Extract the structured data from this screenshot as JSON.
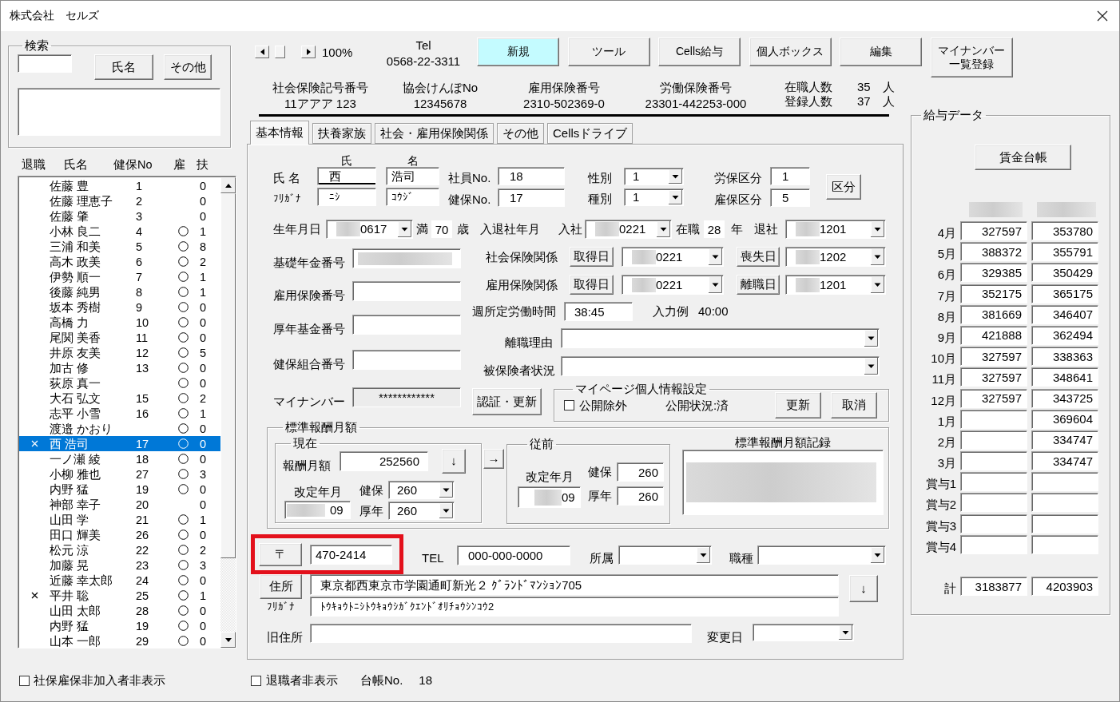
{
  "window": {
    "title": "株式会社　セルズ"
  },
  "search": {
    "title": "検索",
    "buttons": [
      "氏名",
      "その他"
    ]
  },
  "employee_list": {
    "columns": [
      "退職",
      "氏名",
      "健保No",
      "雇",
      "扶"
    ],
    "rows": [
      {
        "retired": false,
        "name": "佐藤 豊",
        "health_no": "1",
        "employment_insured": false,
        "dependents": "0",
        "selected": false
      },
      {
        "retired": false,
        "name": "佐藤 理恵子",
        "health_no": "2",
        "employment_insured": false,
        "dependents": "0",
        "selected": false
      },
      {
        "retired": false,
        "name": "佐藤 肇",
        "health_no": "3",
        "employment_insured": false,
        "dependents": "0",
        "selected": false
      },
      {
        "retired": false,
        "name": "小林 良二",
        "health_no": "4",
        "employment_insured": true,
        "dependents": "1",
        "selected": false
      },
      {
        "retired": false,
        "name": "三浦 和美",
        "health_no": "5",
        "employment_insured": true,
        "dependents": "8",
        "selected": false
      },
      {
        "retired": false,
        "name": "高木 政美",
        "health_no": "6",
        "employment_insured": true,
        "dependents": "2",
        "selected": false
      },
      {
        "retired": false,
        "name": "伊勢 順一",
        "health_no": "7",
        "employment_insured": true,
        "dependents": "1",
        "selected": false
      },
      {
        "retired": false,
        "name": "後藤 純男",
        "health_no": "8",
        "employment_insured": true,
        "dependents": "1",
        "selected": false
      },
      {
        "retired": false,
        "name": "坂本 秀樹",
        "health_no": "9",
        "employment_insured": true,
        "dependents": "0",
        "selected": false
      },
      {
        "retired": false,
        "name": "高橋 力",
        "health_no": "10",
        "employment_insured": true,
        "dependents": "0",
        "selected": false
      },
      {
        "retired": false,
        "name": "尾関 美香",
        "health_no": "11",
        "employment_insured": true,
        "dependents": "0",
        "selected": false
      },
      {
        "retired": false,
        "name": "井原 友美",
        "health_no": "12",
        "employment_insured": true,
        "dependents": "5",
        "selected": false
      },
      {
        "retired": false,
        "name": "加古 修",
        "health_no": "13",
        "employment_insured": true,
        "dependents": "0",
        "selected": false
      },
      {
        "retired": false,
        "name": "荻原 真一",
        "employment_insured": true,
        "dependents": "0",
        "selected": false
      },
      {
        "retired": false,
        "name": "大石 弘文",
        "health_no": "15",
        "employment_insured": true,
        "dependents": "2",
        "selected": false
      },
      {
        "retired": false,
        "name": "志平 小雪",
        "health_no": "16",
        "employment_insured": true,
        "dependents": "1",
        "selected": false
      },
      {
        "retired": false,
        "name": "渡邉 かおり",
        "employment_insured": true,
        "dependents": "0",
        "selected": false
      },
      {
        "retired": true,
        "name": "西 浩司",
        "health_no": "17",
        "employment_insured": true,
        "dependents": "0",
        "selected": true
      },
      {
        "retired": false,
        "name": "一ノ瀬 綾",
        "health_no": "18",
        "employment_insured": true,
        "dependents": "0",
        "selected": false
      },
      {
        "retired": false,
        "name": "小柳 雅也",
        "health_no": "27",
        "employment_insured": true,
        "dependents": "3",
        "selected": false
      },
      {
        "retired": false,
        "name": "内野 猛",
        "health_no": "19",
        "employment_insured": true,
        "dependents": "0",
        "selected": false
      },
      {
        "retired": false,
        "name": "神部 幸子",
        "health_no": "20",
        "employment_insured": false,
        "dependents": "0",
        "selected": false
      },
      {
        "retired": false,
        "name": "山田 学",
        "health_no": "21",
        "employment_insured": true,
        "dependents": "1",
        "selected": false
      },
      {
        "retired": false,
        "name": "田口 輝美",
        "health_no": "26",
        "employment_insured": true,
        "dependents": "0",
        "selected": false
      },
      {
        "retired": false,
        "name": "松元 涼",
        "health_no": "22",
        "employment_insured": true,
        "dependents": "2",
        "selected": false
      },
      {
        "retired": false,
        "name": "加藤 晃",
        "health_no": "23",
        "employment_insured": true,
        "dependents": "3",
        "selected": false
      },
      {
        "retired": false,
        "name": "近藤 幸太郎",
        "health_no": "24",
        "employment_insured": true,
        "dependents": "0",
        "selected": false
      },
      {
        "retired": true,
        "name": "平井 聡",
        "health_no": "25",
        "employment_insured": true,
        "dependents": "1",
        "selected": false
      },
      {
        "retired": false,
        "name": "山田 太郎",
        "health_no": "28",
        "employment_insured": true,
        "dependents": "0",
        "selected": false
      },
      {
        "retired": false,
        "name": "内野 猛",
        "health_no": "19",
        "employment_insured": true,
        "dependents": "0",
        "selected": false
      },
      {
        "retired": false,
        "name": "山本 一郎",
        "health_no": "29",
        "employment_insured": true,
        "dependents": "0",
        "selected": false
      }
    ]
  },
  "hide_uninsured": {
    "label": "社保雇保非加入者非表示",
    "checked": false
  },
  "toolbar": {
    "zoom": "100%",
    "tel_label": "Tel",
    "tel": "0568-22-3311",
    "buttons": [
      {
        "label": "新規",
        "highlighted": true
      },
      {
        "label": "ツール",
        "highlighted": false
      },
      {
        "label": "Cells給与",
        "highlighted": false
      },
      {
        "label": "個人ボックス",
        "highlighted": false
      },
      {
        "label": "編集",
        "highlighted": false
      },
      {
        "label": "マイナンバー一覧登録",
        "highlighted": false
      }
    ]
  },
  "office_numbers": [
    {
      "label": "社会保険記号番号",
      "value": "11アアア 123"
    },
    {
      "label": "協会けんぽNo",
      "value": "12345678"
    },
    {
      "label": "雇用保険番号",
      "value": "2310-502369-0"
    },
    {
      "label": "労働保険番号",
      "value": "23301-442253-000"
    }
  ],
  "headcount": [
    {
      "label": "在職人数",
      "value": "35",
      "unit": "人"
    },
    {
      "label": "登録人数",
      "value": "37",
      "unit": "人"
    }
  ],
  "tabs": [
    {
      "label": "基本情報",
      "selected": true
    },
    {
      "label": "扶養家族",
      "selected": false
    },
    {
      "label": "社会・雇用保険関係",
      "selected": false
    },
    {
      "label": "その他",
      "selected": false
    },
    {
      "label": "Cellsドライブ",
      "selected": false
    }
  ],
  "basic_info": {
    "name": {
      "surname_heading": "氏",
      "given_heading": "名",
      "label": "氏 名",
      "surname": "西",
      "surname_focused": true,
      "given": "浩司",
      "kana_label": "ﾌﾘｶﾞﾅ",
      "surname_kana": "ﾆｼ",
      "given_kana": "ｺｳｼﾞ"
    },
    "numbers": [
      {
        "label": "社員No.",
        "value": "18"
      },
      {
        "label": "健保No.",
        "value": "17"
      }
    ],
    "selects": [
      {
        "label": "性別",
        "value": "1"
      },
      {
        "label": "種別",
        "value": "1"
      }
    ],
    "classes": [
      {
        "label": "労保区分",
        "value": "1"
      },
      {
        "label": "雇保区分",
        "value": "5"
      }
    ],
    "class_button": "区分",
    "birth": {
      "label": "生年月日",
      "value": "0617",
      "age_prefix": "満",
      "age": "70",
      "age_unit": "歳"
    },
    "tenure": {
      "label": "入退社年月",
      "join_label": "入社",
      "join": "0221",
      "years_label": "在職",
      "years": "28",
      "years_unit": "年",
      "leave_label": "退社",
      "leave": "1201"
    },
    "id_fields": [
      {
        "label": "基礎年金番号",
        "kind": "blurred"
      },
      {
        "label": "雇用保険番号",
        "kind": "text"
      },
      {
        "label": "厚年基金番号",
        "kind": "text"
      },
      {
        "label": "健保組合番号",
        "kind": "text"
      },
      {
        "label": "マイナンバー",
        "kind": "readonly",
        "value": "************"
      }
    ],
    "insurance_rows": [
      {
        "label": "社会保険関係",
        "acquire_button": "取得日",
        "acquire": "0221",
        "lose_button": "喪失日",
        "lose": "1202"
      },
      {
        "label": "雇用保険関係",
        "acquire_button": "取得日",
        "acquire": "0221",
        "lose_button": "離職日",
        "lose": "1201"
      }
    ],
    "weekly_hours": {
      "label": "週所定労働時間",
      "value": "38:45",
      "example_label": "入力例",
      "example": "40:00"
    },
    "leave_reason": {
      "label": "離職理由"
    },
    "insured_status": {
      "label": "被保険者状況"
    },
    "auth_button": "認証・更新",
    "mypage": {
      "title": "マイページ個人情報設定",
      "exclude_label": "公開除外",
      "exclude_checked": false,
      "status": "公開状況:済",
      "buttons": [
        "更新",
        "取消"
      ]
    },
    "standard_pay": {
      "title": "標準報酬月額",
      "current": {
        "title": "現在",
        "pay_label": "報酬月額",
        "pay": "252560",
        "down_button": "↓",
        "revision_label": "改定年月",
        "revision": "09",
        "health_label": "健保",
        "health": "260",
        "pension_label": "厚年",
        "pension": "260"
      },
      "copy_button": "→",
      "previous": {
        "title": "従前",
        "revision_label": "改定年月",
        "revision": "09",
        "health_label": "健保",
        "health": "260",
        "pension_label": "厚年",
        "pension": "260"
      },
      "record_title": "標準報酬月額記録"
    },
    "address": {
      "postal_button": "〒",
      "postal": "470-2414",
      "postal_highlighted": true,
      "tel_label": "TEL",
      "tel": "000-000-0000",
      "dept_label": "所属",
      "job_label": "職種",
      "address_button": "住所",
      "address": "東京都西東京市学園通町新光２ ｸﾞﾗﾝﾄﾞﾏﾝｼｮﾝ705",
      "kana_label": "ﾌﾘｶﾞﾅ",
      "address_kana": "ﾄｳｷｮｳﾄﾆｼﾄｳｷｮｳｼｶﾞｸｴﾝﾄﾞｵﾘﾁｮｳｼﾝｺｳ2",
      "copy_button": "↓",
      "old_label": "旧住所",
      "change_label": "変更日"
    }
  },
  "salary_data": {
    "title": "給与データ",
    "button": "賃金台帳",
    "rows": [
      {
        "label": "4月",
        "column_1": "327597",
        "column_2": "353780"
      },
      {
        "label": "5月",
        "column_1": "388372",
        "column_2": "355791"
      },
      {
        "label": "6月",
        "column_1": "329385",
        "column_2": "350429"
      },
      {
        "label": "7月",
        "column_1": "352175",
        "column_2": "365175"
      },
      {
        "label": "8月",
        "column_1": "381669",
        "column_2": "346407"
      },
      {
        "label": "9月",
        "column_1": "421888",
        "column_2": "362494"
      },
      {
        "label": "10月",
        "column_1": "327597",
        "column_2": "338363"
      },
      {
        "label": "11月",
        "column_1": "327597",
        "column_2": "348641"
      },
      {
        "label": "12月",
        "column_1": "327597",
        "column_2": "343725"
      },
      {
        "label": "1月",
        "column_2": "369604"
      },
      {
        "label": "2月",
        "column_2": "334747"
      },
      {
        "label": "3月",
        "column_2": "334747"
      },
      {
        "label": "賞与1"
      },
      {
        "label": "賞与2"
      },
      {
        "label": "賞与3"
      },
      {
        "label": "賞与4"
      }
    ],
    "total": {
      "label": "計",
      "column_1": "3183877",
      "column_2": "4203903"
    }
  },
  "footer": {
    "hide_retired_label": "退職者非表示",
    "hide_retired_checked": false,
    "ledger_label": "台帳No.",
    "ledger_no": "18"
  }
}
